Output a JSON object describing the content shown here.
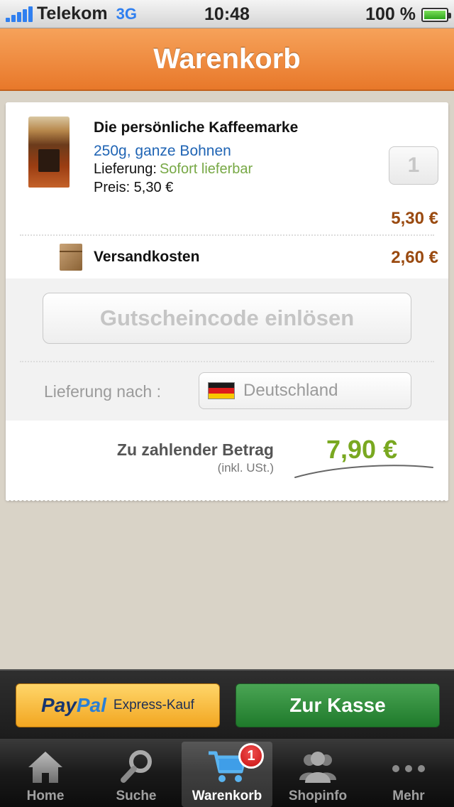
{
  "status_bar": {
    "carrier": "Telekom",
    "network": "3G",
    "time": "10:48",
    "battery": "100 %",
    "battery_level": 1.0
  },
  "header": {
    "title": "Warenkorb"
  },
  "cart": {
    "item": {
      "name": "Die persönliche Kaffeemarke",
      "variant": "250g, ganze Bohnen",
      "delivery_label": "Lieferung:",
      "delivery_status": "Sofort lieferbar",
      "price_label": "Preis: 5,30 €",
      "quantity": "1",
      "line_total": "5,30 €"
    },
    "shipping": {
      "label": "Versandkosten",
      "cost": "2,60 €"
    },
    "voucher_button": "Gutscheincode einlösen",
    "delivery_to_label": "Lieferung nach :",
    "country": "Deutschland",
    "total_label": "Zu zahlender Betrag",
    "total_note": "(inkl. USt.)",
    "total_amount": "7,90 €"
  },
  "actions": {
    "paypal_pay": "Pay",
    "paypal_pal": "Pal",
    "paypal_label": "Express-Kauf",
    "checkout_label": "Zur Kasse"
  },
  "tabbar": {
    "tabs": [
      {
        "label": "Home",
        "icon": "home-icon"
      },
      {
        "label": "Suche",
        "icon": "search-icon"
      },
      {
        "label": "Warenkorb",
        "icon": "cart-icon",
        "badge": "1"
      },
      {
        "label": "Shopinfo",
        "icon": "people-icon"
      },
      {
        "label": "Mehr",
        "icon": "more-icon"
      }
    ],
    "active": "Warenkorb"
  },
  "colors": {
    "header_orange": "#e8782a",
    "price_brown": "#9a4a10",
    "total_green": "#79a820",
    "checkout_green": "#1f7a2b",
    "paypal_yellow": "#f2a621",
    "link_blue": "#1f64b4"
  }
}
